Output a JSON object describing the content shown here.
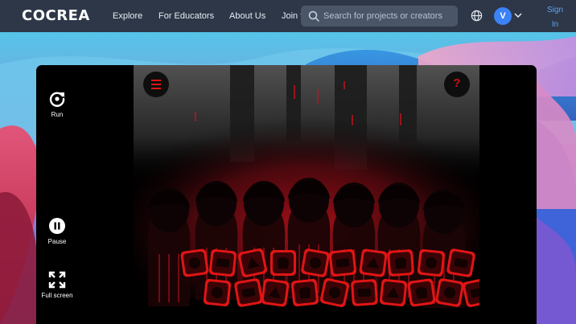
{
  "brand": {
    "logo_text": "COCREA"
  },
  "nav": {
    "explore": "Explore",
    "educators": "For Educators",
    "about": "About Us",
    "join": "Join the community"
  },
  "search": {
    "placeholder": "Search for projects or creators",
    "icon": "search-icon"
  },
  "account": {
    "avatar_initial": "V",
    "signin_label": "Sign In"
  },
  "player": {
    "controls": {
      "run_label": "Run",
      "pause_label": "Pause",
      "fullscreen_label": "Full screen"
    },
    "game": {
      "menu_icon": "hamburger-menu-icon",
      "hint_label": "?",
      "characters": [
        "character-1",
        "character-2",
        "character-3",
        "character-4",
        "character-5",
        "character-6",
        "character-7"
      ],
      "sound_buttons_row1": [
        "sound-1",
        "sound-2",
        "sound-3",
        "sound-4",
        "sound-5",
        "sound-6",
        "sound-7",
        "sound-8",
        "sound-9",
        "sound-10"
      ],
      "sound_buttons_row2": [
        "sound-11",
        "sound-12",
        "sound-13",
        "sound-14",
        "sound-15",
        "sound-16",
        "sound-17",
        "sound-18",
        "sound-19",
        "sound-20"
      ]
    }
  },
  "colors": {
    "topbar": "#2d3748",
    "accent_link": "#5aa5f5",
    "avatar": "#3b82f6",
    "game_red": "#e01515"
  }
}
